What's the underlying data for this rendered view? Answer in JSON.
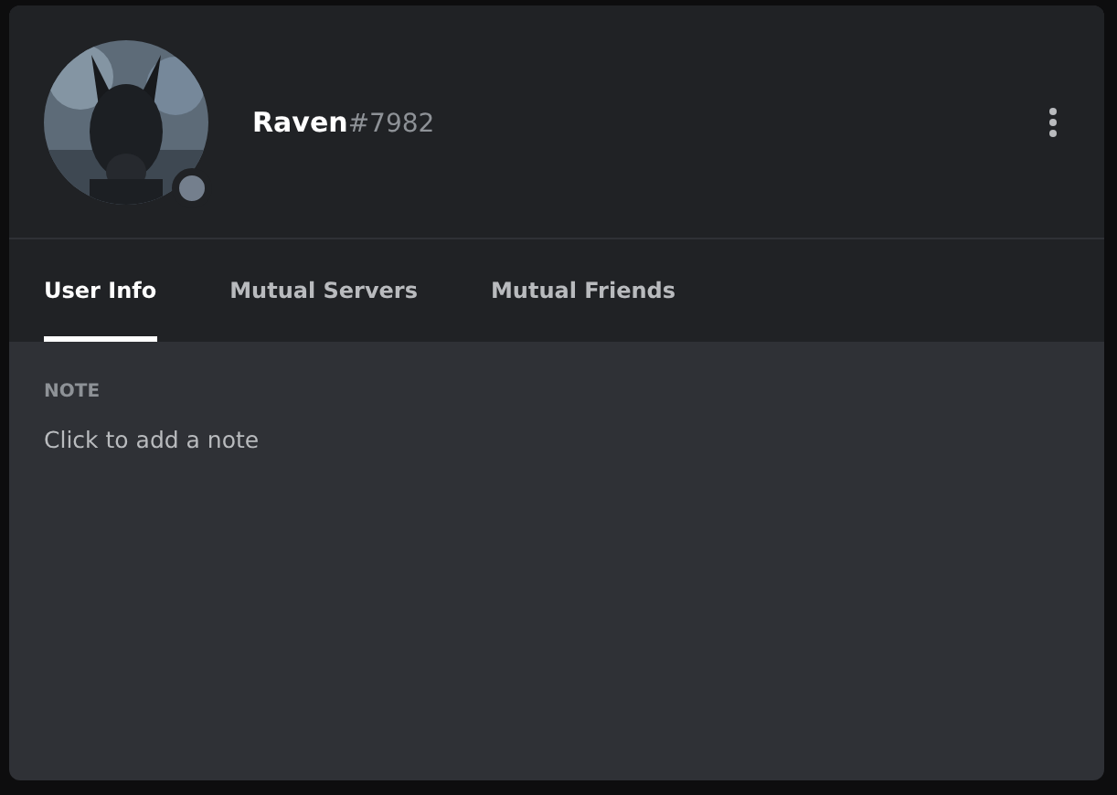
{
  "profile": {
    "online": false,
    "username": "Raven",
    "discriminator": "#7982"
  },
  "tabs": [
    {
      "label": "User Info",
      "selected": true
    },
    {
      "label": "Mutual Servers",
      "selected": false
    },
    {
      "label": "Mutual Friends",
      "selected": false
    }
  ],
  "note": {
    "heading": "NOTE",
    "placeholder": "Click to add a note"
  }
}
